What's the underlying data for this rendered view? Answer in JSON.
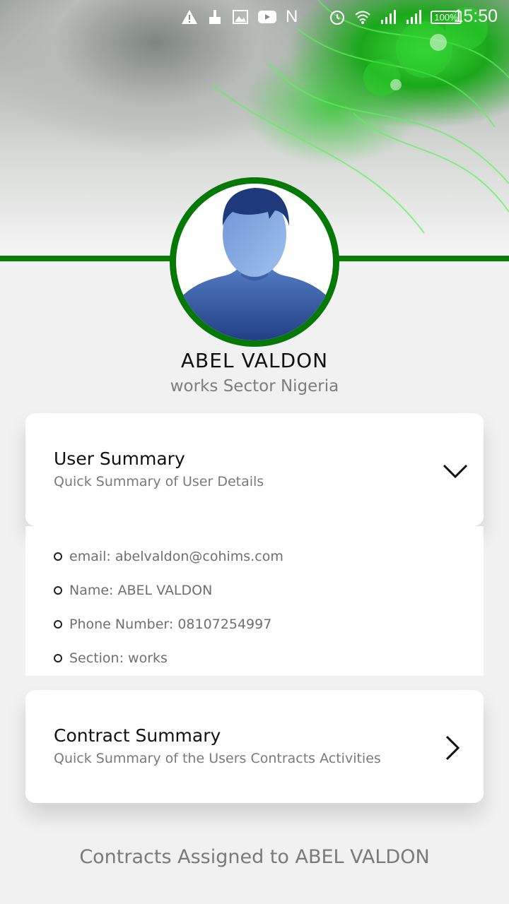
{
  "status_bar": {
    "time": "15:50",
    "battery": "100%"
  },
  "profile": {
    "name": "ABEL VALDON",
    "subtitle": "works Sector Nigeria"
  },
  "user_summary": {
    "title": "User Summary",
    "subtitle": "Quick Summary of User Details",
    "details": [
      "email: abelvaldon@cohims.com",
      "Name: ABEL VALDON",
      "Phone Number: 08107254997",
      "Section: works"
    ]
  },
  "contract_summary": {
    "title": "Contract Summary",
    "subtitle": "Quick Summary of the Users Contracts Activities"
  },
  "footer": {
    "contracts_heading": "Contracts Assigned to ABEL VALDON"
  },
  "colors": {
    "accent_green": "#067806",
    "card_bg": "#ffffff",
    "page_bg": "#f1f1f1"
  }
}
